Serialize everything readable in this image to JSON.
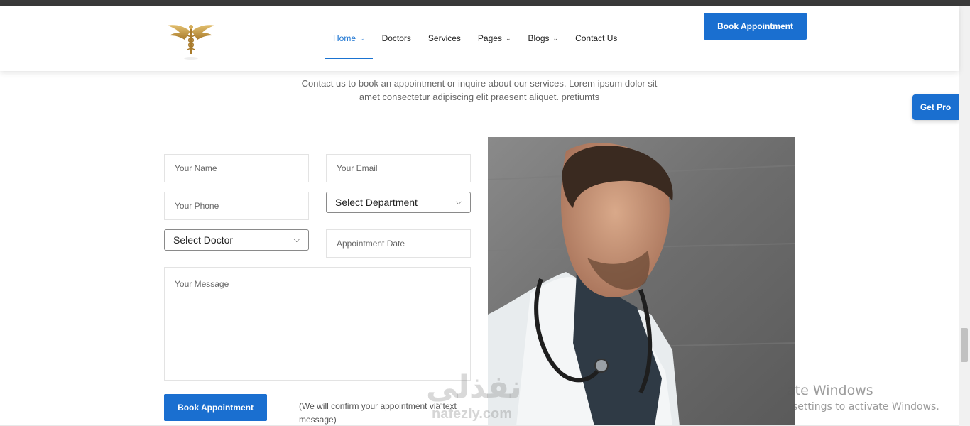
{
  "nav": {
    "items": [
      {
        "label": "Home",
        "has_dropdown": true,
        "active": true
      },
      {
        "label": "Doctors",
        "has_dropdown": false
      },
      {
        "label": "Services",
        "has_dropdown": false
      },
      {
        "label": "Pages",
        "has_dropdown": true
      },
      {
        "label": "Blogs",
        "has_dropdown": true
      },
      {
        "label": "Contact Us",
        "has_dropdown": false
      }
    ],
    "book_button_label": "Book Appointment",
    "logo_icon": "caduceus-wings-logo"
  },
  "intro": {
    "text": "Contact us to book an appointment or inquire about our services. Lorem ipsum dolor sit amet consectetur adipiscing elit praesent aliquet. pretiumts"
  },
  "get_pro_label": "Get Pro",
  "form": {
    "name_placeholder": "Your Name",
    "email_placeholder": "Your Email",
    "phone_placeholder": "Your Phone",
    "department_selected": "Select Department",
    "doctor_selected": "Select Doctor",
    "date_placeholder": "Appointment Date",
    "message_placeholder": "Your Message",
    "submit_label": "Book Appointment",
    "confirm_note": "(We will confirm your appointment via text message)"
  },
  "watermark": {
    "arabic": "نفذلي",
    "url": "nafezly.com"
  },
  "windows_activation": {
    "line1": "ate Windows",
    "line2": "settings to activate Windows."
  },
  "colors": {
    "accent": "#1a6fd0",
    "active_nav": "#1a73d1",
    "logo_gold": "#c9a04a"
  }
}
